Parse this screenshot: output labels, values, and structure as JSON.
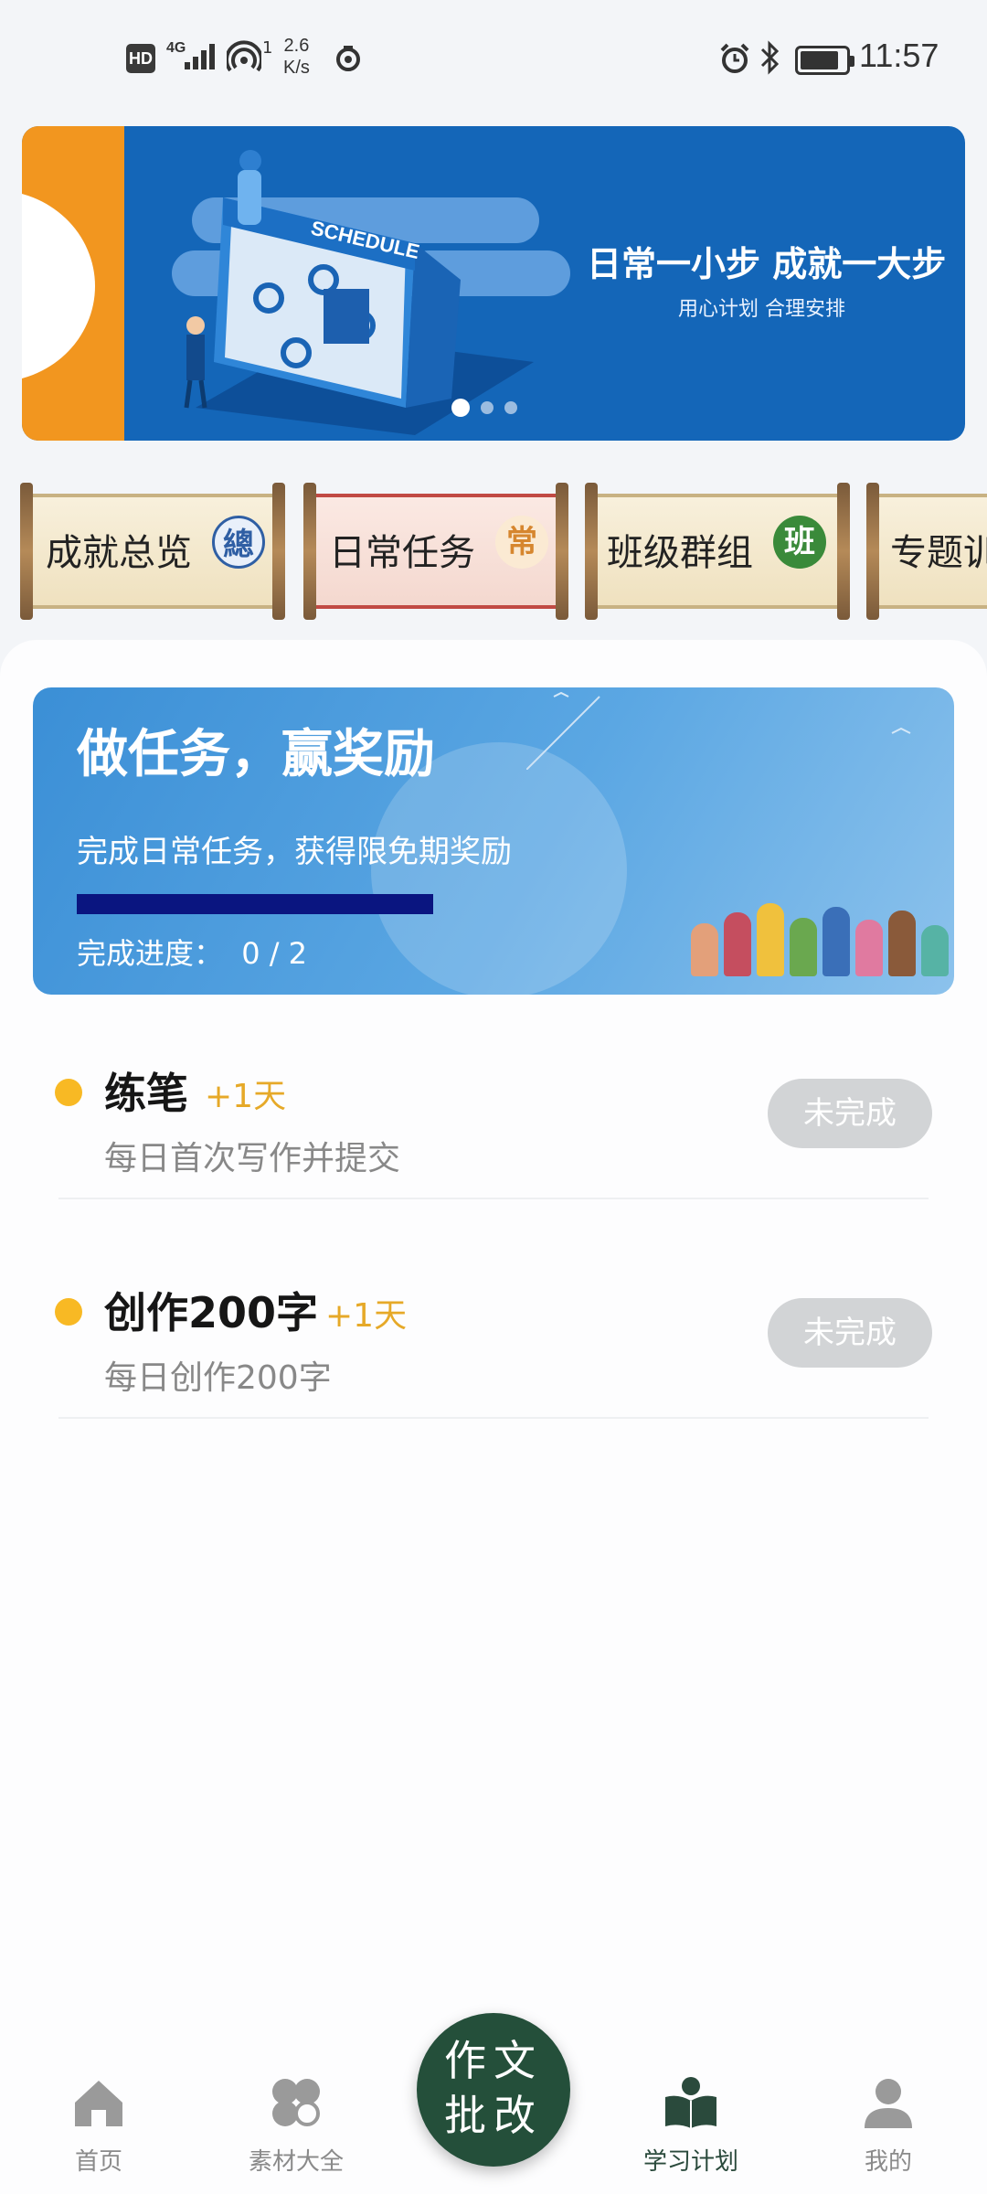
{
  "status_bar": {
    "hd": "HD",
    "network": "4G",
    "hotspot_count": "1",
    "speed_value": "2.6",
    "speed_unit": "K/s",
    "time": "11:57"
  },
  "banner": {
    "headline": "日常一小步 成就一大步",
    "subline": "用心计划  合理安排",
    "art_text": "SCHEDULE",
    "active_slide": 1,
    "slide_count": 3
  },
  "scroll_nav": [
    {
      "label": "成就总览",
      "seal": "總",
      "seal_color": "#2f5fa4"
    },
    {
      "label": "日常任务",
      "seal": "常",
      "seal_color": "#d6862e"
    },
    {
      "label": "班级群组",
      "seal": "班",
      "seal_color": "#3a8a3a"
    },
    {
      "label": "专题训",
      "seal": "",
      "seal_color": "#2f5fa4"
    }
  ],
  "promo": {
    "title": "做任务，赢奖励",
    "description": "完成日常任务，获得限免期奖励",
    "progress_label": "完成进度：",
    "progress_text": "0 / 2",
    "progress_done": 0,
    "progress_total": 2
  },
  "tasks": [
    {
      "name": "练笔",
      "bonus": "+1天",
      "description": "每日首次写作并提交",
      "status": "未完成"
    },
    {
      "name": "创作200字",
      "bonus": "+1天",
      "description": "每日创作200字",
      "status": "未完成"
    }
  ],
  "bottom_nav": {
    "items": [
      {
        "label": "首页",
        "icon": "home-icon"
      },
      {
        "label": "素材大全",
        "icon": "clover-icon"
      },
      {
        "label": "学习计划",
        "icon": "book-icon",
        "active": true
      },
      {
        "label": "我的",
        "icon": "profile-icon"
      }
    ],
    "center": {
      "line1": "作文",
      "line2": "批改"
    }
  },
  "colors": {
    "accent_dark_green": "#244f3a",
    "banner_blue": "#1466b8",
    "bullet_yellow": "#f8b924",
    "bonus_orange": "#e6a928",
    "progress_fill": "#0a1580"
  }
}
